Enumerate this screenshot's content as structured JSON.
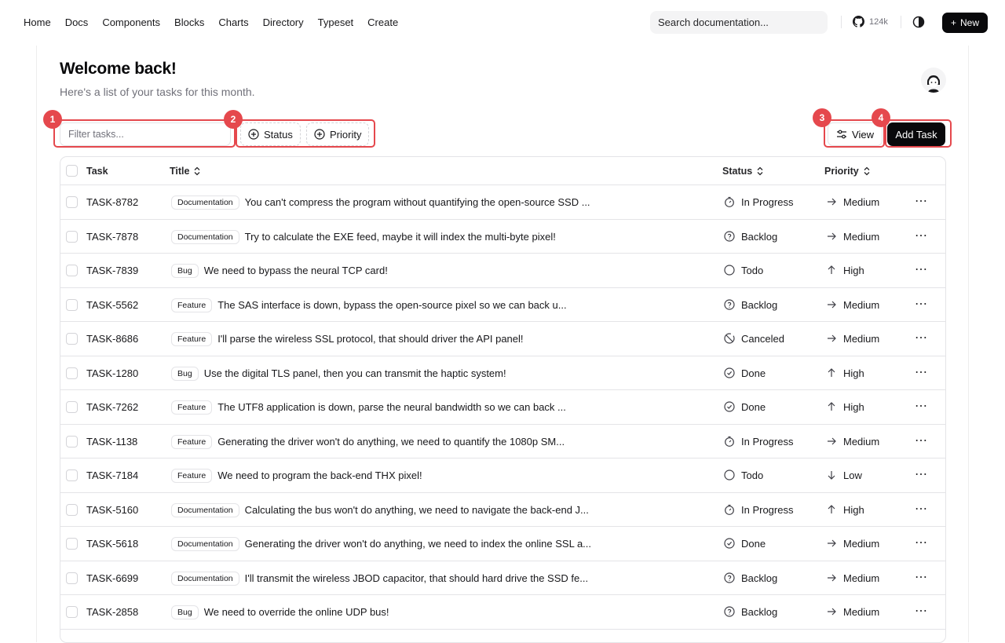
{
  "nav": {
    "links": [
      "Home",
      "Docs",
      "Components",
      "Blocks",
      "Charts",
      "Directory",
      "Typeset",
      "Create"
    ],
    "search_placeholder": "Search documentation...",
    "github_stars": "124k",
    "new_label": "New"
  },
  "page": {
    "title": "Welcome back!",
    "subtitle": "Here's a list of your tasks for this month."
  },
  "toolbar": {
    "filter_placeholder": "Filter tasks...",
    "status_label": "Status",
    "priority_label": "Priority",
    "view_label": "View",
    "add_label": "Add Task",
    "markers": [
      "1",
      "2",
      "3",
      "4"
    ]
  },
  "table": {
    "headers": [
      "Task",
      "Title",
      "Status",
      "Priority"
    ],
    "rows": [
      {
        "id": "TASK-8782",
        "label": "Documentation",
        "title": "You can't compress the program without quantifying the open-source SSD ...",
        "status": "In Progress",
        "priority": "Medium"
      },
      {
        "id": "TASK-7878",
        "label": "Documentation",
        "title": "Try to calculate the EXE feed, maybe it will index the multi-byte pixel!",
        "status": "Backlog",
        "priority": "Medium"
      },
      {
        "id": "TASK-7839",
        "label": "Bug",
        "title": "We need to bypass the neural TCP card!",
        "status": "Todo",
        "priority": "High"
      },
      {
        "id": "TASK-5562",
        "label": "Feature",
        "title": "The SAS interface is down, bypass the open-source pixel so we can back u...",
        "status": "Backlog",
        "priority": "Medium"
      },
      {
        "id": "TASK-8686",
        "label": "Feature",
        "title": "I'll parse the wireless SSL protocol, that should driver the API panel!",
        "status": "Canceled",
        "priority": "Medium"
      },
      {
        "id": "TASK-1280",
        "label": "Bug",
        "title": "Use the digital TLS panel, then you can transmit the haptic system!",
        "status": "Done",
        "priority": "High"
      },
      {
        "id": "TASK-7262",
        "label": "Feature",
        "title": "The UTF8 application is down, parse the neural bandwidth so we can back ...",
        "status": "Done",
        "priority": "High"
      },
      {
        "id": "TASK-1138",
        "label": "Feature",
        "title": "Generating the driver won't do anything, we need to quantify the 1080p SM...",
        "status": "In Progress",
        "priority": "Medium"
      },
      {
        "id": "TASK-7184",
        "label": "Feature",
        "title": "We need to program the back-end THX pixel!",
        "status": "Todo",
        "priority": "Low"
      },
      {
        "id": "TASK-5160",
        "label": "Documentation",
        "title": "Calculating the bus won't do anything, we need to navigate the back-end J...",
        "status": "In Progress",
        "priority": "High"
      },
      {
        "id": "TASK-5618",
        "label": "Documentation",
        "title": "Generating the driver won't do anything, we need to index the online SSL a...",
        "status": "Done",
        "priority": "Medium"
      },
      {
        "id": "TASK-6699",
        "label": "Documentation",
        "title": "I'll transmit the wireless JBOD capacitor, that should hard drive the SSD fe...",
        "status": "Backlog",
        "priority": "Medium"
      },
      {
        "id": "TASK-2858",
        "label": "Bug",
        "title": "We need to override the online UDP bus!",
        "status": "Backlog",
        "priority": "Medium"
      }
    ],
    "row_menu_icon": "ellipsis-icon"
  },
  "colors": {
    "accent": "#09090b",
    "highlight": "#e5484d",
    "muted_text": "#71717a",
    "border": "#e4e4e7"
  }
}
